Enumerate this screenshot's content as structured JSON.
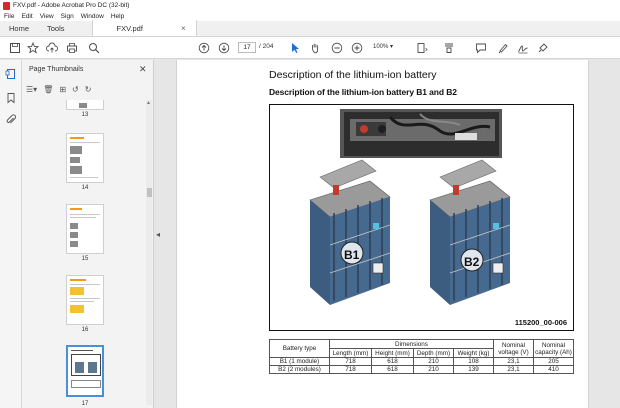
{
  "window": {
    "title": "FXV.pdf - Adobe Acrobat Pro DC (32-bit)"
  },
  "menu": [
    "File",
    "Edit",
    "View",
    "Sign",
    "Window",
    "Help"
  ],
  "tabs": {
    "home": "Home",
    "tools": "Tools",
    "document": "FXV.pdf"
  },
  "toolbar": {
    "current_page": "17",
    "total_pages": "/ 204",
    "zoom": "100%"
  },
  "panel": {
    "title": "Page Thumbnails",
    "thumbnails": [
      {
        "label": "13"
      },
      {
        "label": "14"
      },
      {
        "label": "15"
      },
      {
        "label": "16"
      },
      {
        "label": "17",
        "selected": true
      }
    ]
  },
  "document": {
    "heading": "Description of the lithium-ion battery",
    "subheading": "Description of the lithium-ion battery B1 and B2",
    "figure": {
      "id": "115200_00-006",
      "label_b1": "B1",
      "label_b2": "B2"
    },
    "table": {
      "header_type": "Battery type",
      "header_dimensions": "Dimensions",
      "header_length": "Length (mm)",
      "header_height": "Height (mm)",
      "header_depth": "Depth (mm)",
      "header_weight": "Weight (kg)",
      "header_voltage": "Nominal voltage (V)",
      "header_capacity": "Nominal capacity (Ah)",
      "rows": [
        {
          "type": "B1 (1 module)",
          "length": "718",
          "height": "618",
          "depth": "210",
          "weight": "108",
          "voltage": "23,1",
          "capacity": "205"
        },
        {
          "type": "B2 (2 modules)",
          "length": "718",
          "height": "618",
          "depth": "210",
          "weight": "139",
          "voltage": "23,1",
          "capacity": "410"
        }
      ]
    }
  },
  "colors": {
    "accent": "#d9262a",
    "selection": "#4a90d9",
    "thumb_accent": "#f39c12"
  }
}
